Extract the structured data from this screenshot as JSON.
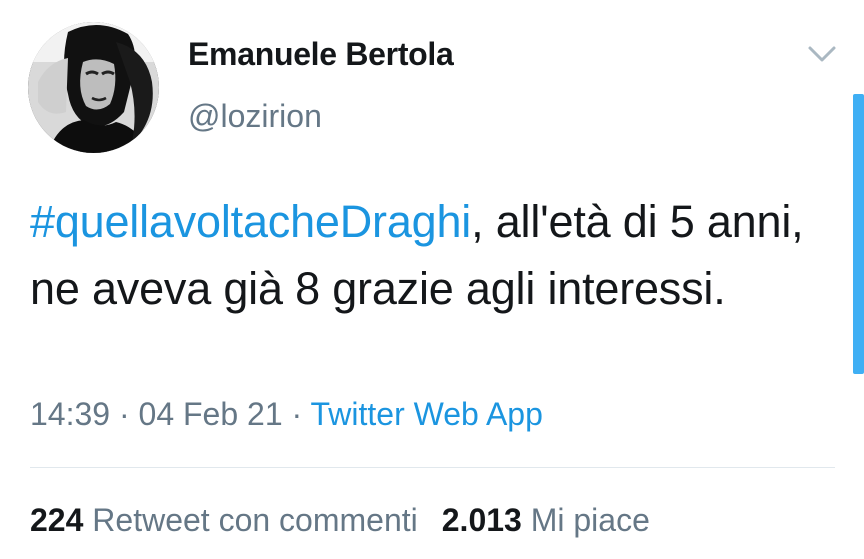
{
  "author": {
    "display_name": "Emanuele Bertola",
    "handle": "@lozirion"
  },
  "tweet": {
    "hashtag": "#quellavoltacheDraghi",
    "text_rest": ", all'età di 5 anni, ne aveva già 8 grazie agli interessi."
  },
  "meta": {
    "time": "14:39",
    "separator": "·",
    "date": "04 Feb 21",
    "source": "Twitter Web App"
  },
  "stats": {
    "retweets_count": "224",
    "retweets_label": "Retweet con commenti",
    "likes_count": "2.013",
    "likes_label": "Mi piace"
  },
  "icons": {
    "chevron": "chevron-down-icon",
    "avatar": "avatar"
  },
  "colors": {
    "link": "#1b95e0",
    "secondary_text": "#657786",
    "primary_text": "#14171a",
    "scrollbar": "#1da1f2"
  }
}
